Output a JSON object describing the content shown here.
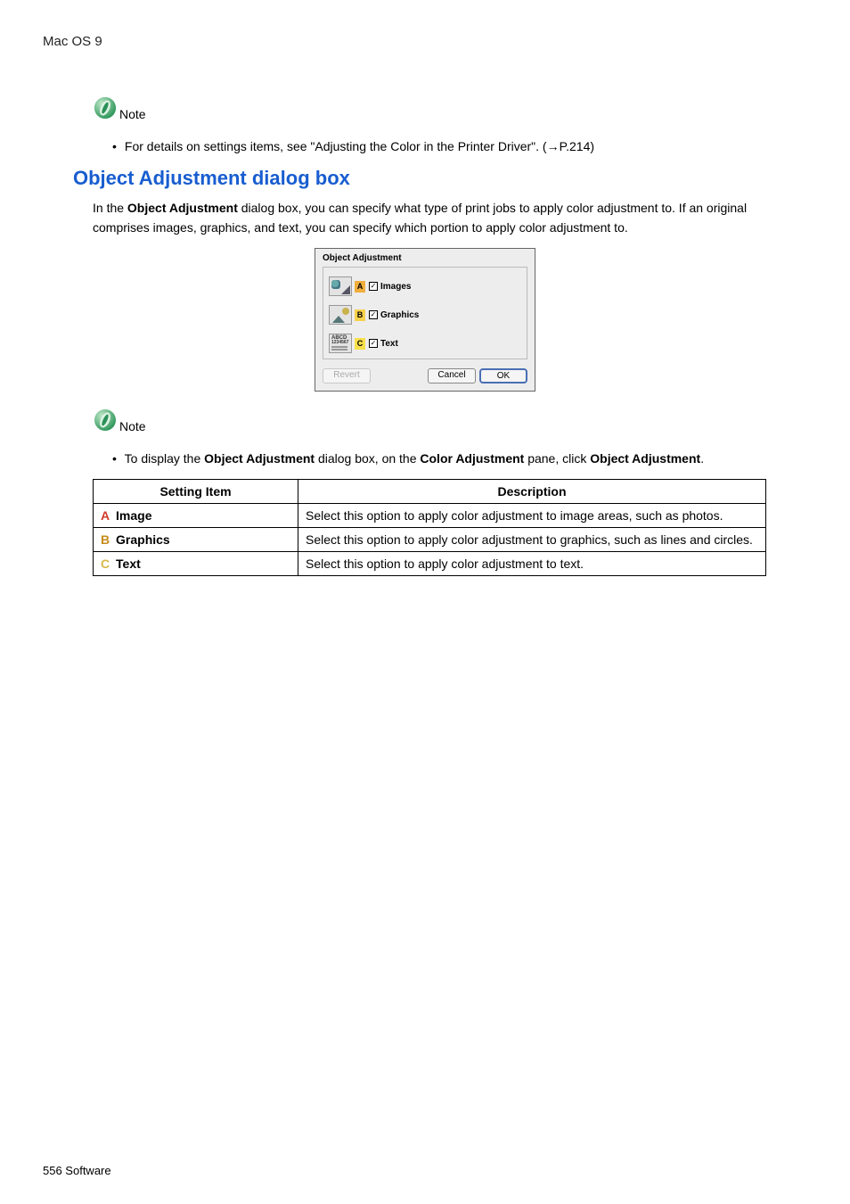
{
  "breadcrumb": "Mac OS 9",
  "note_label": "Note",
  "note1_text": "For details on settings items, see \"Adjusting the Color in the Printer Driver\". (→P.214)",
  "section_heading": "Object Adjustment dialog box",
  "intro": {
    "p1": "In the ",
    "bold1": "Object Adjustment",
    "p2": " dialog box, you can specify what type of print jobs to apply color adjustment to. If an original comprises images, graphics, and text, you can specify which portion to apply color adjustment to."
  },
  "dialog": {
    "title": "Object Adjustment",
    "images_label": "Images",
    "graphics_label": "Graphics",
    "text_label": "Text",
    "thumb_text": "ABCD",
    "thumb_nums": "1234567",
    "tagA": "A",
    "tagB": "B",
    "tagC": "C",
    "check": "✓",
    "revert": "Revert",
    "cancel": "Cancel",
    "ok": "OK"
  },
  "note2": {
    "pre": "To display the ",
    "b1": "Object Adjustment",
    "mid1": " dialog box, on the ",
    "b2": "Color Adjustment",
    "mid2": " pane, click ",
    "b3": "Object Adjustment",
    "post": "."
  },
  "table": {
    "h1": "Setting Item",
    "h2": "Description",
    "rows": [
      {
        "markClass": "rk-a",
        "mark": "A",
        "name": "Image",
        "desc": "Select this option to apply color adjustment to image areas, such as photos."
      },
      {
        "markClass": "rk-b",
        "mark": "B",
        "name": "Graphics",
        "desc": "Select this option to apply color adjustment to graphics, such as lines and circles."
      },
      {
        "markClass": "rk-c",
        "mark": "C",
        "name": "Text",
        "desc": "Select this option to apply color adjustment to text."
      }
    ]
  },
  "footer": "556  Software"
}
